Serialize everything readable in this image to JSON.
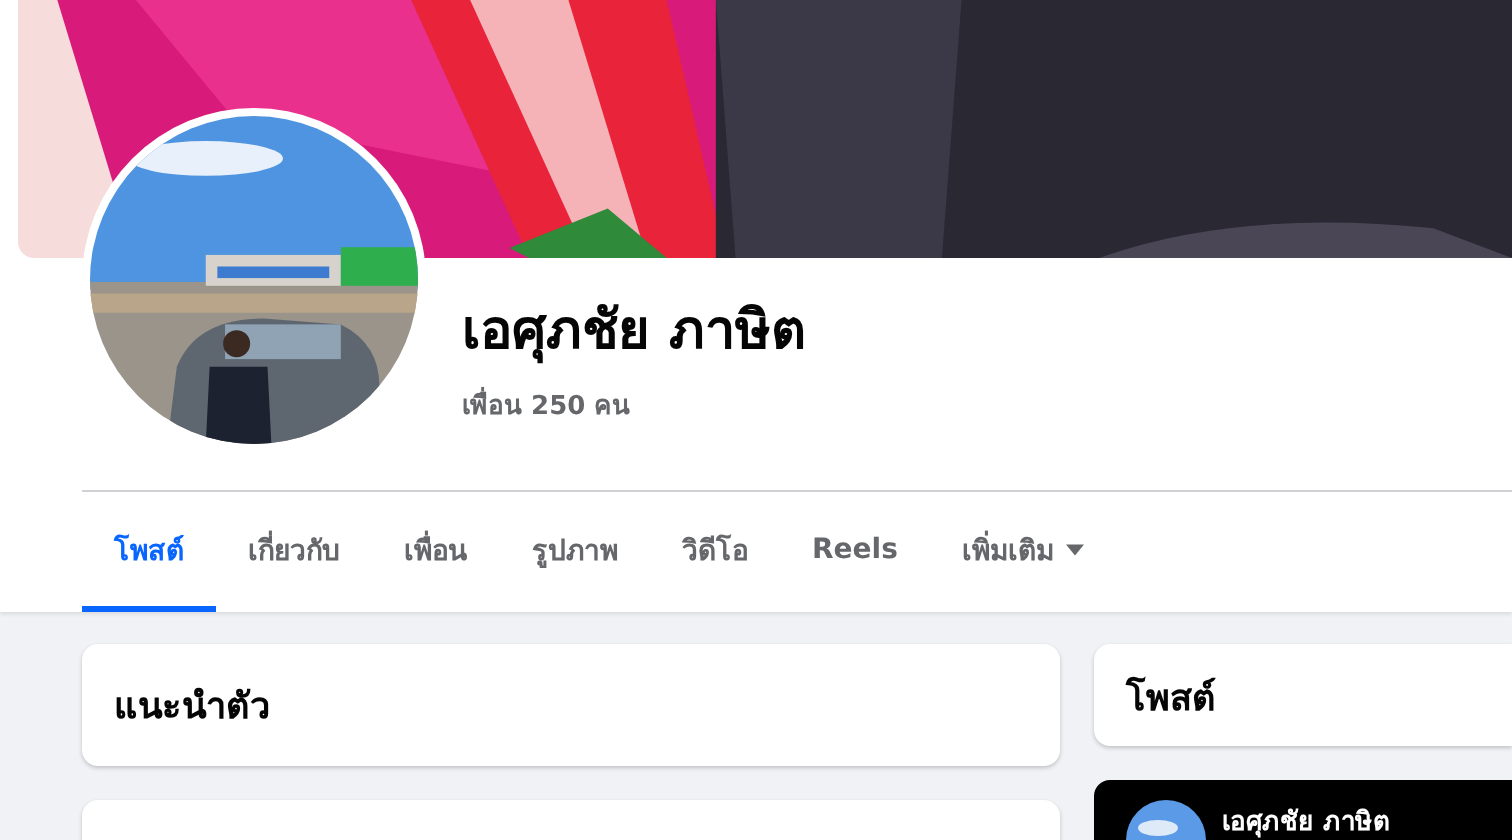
{
  "profile": {
    "name": "เอศุภชัย ภาษิต",
    "friends": "เพื่อน 250 คน"
  },
  "tabs": [
    {
      "label": "โพสต์",
      "selected": true
    },
    {
      "label": "เกี่ยวกับ",
      "selected": false
    },
    {
      "label": "เพื่อน",
      "selected": false
    },
    {
      "label": "รูปภาพ",
      "selected": false
    },
    {
      "label": "วิดีโอ",
      "selected": false
    },
    {
      "label": "Reels",
      "selected": false
    },
    {
      "label": "เพิ่มเติม",
      "selected": false,
      "kind": "menu"
    }
  ],
  "intro_card": {
    "title": "แนะนำตัว"
  },
  "posts_card": {
    "title": "โพสต์"
  },
  "post_preview": {
    "author": "เอศุภชัย ภาษิต"
  }
}
